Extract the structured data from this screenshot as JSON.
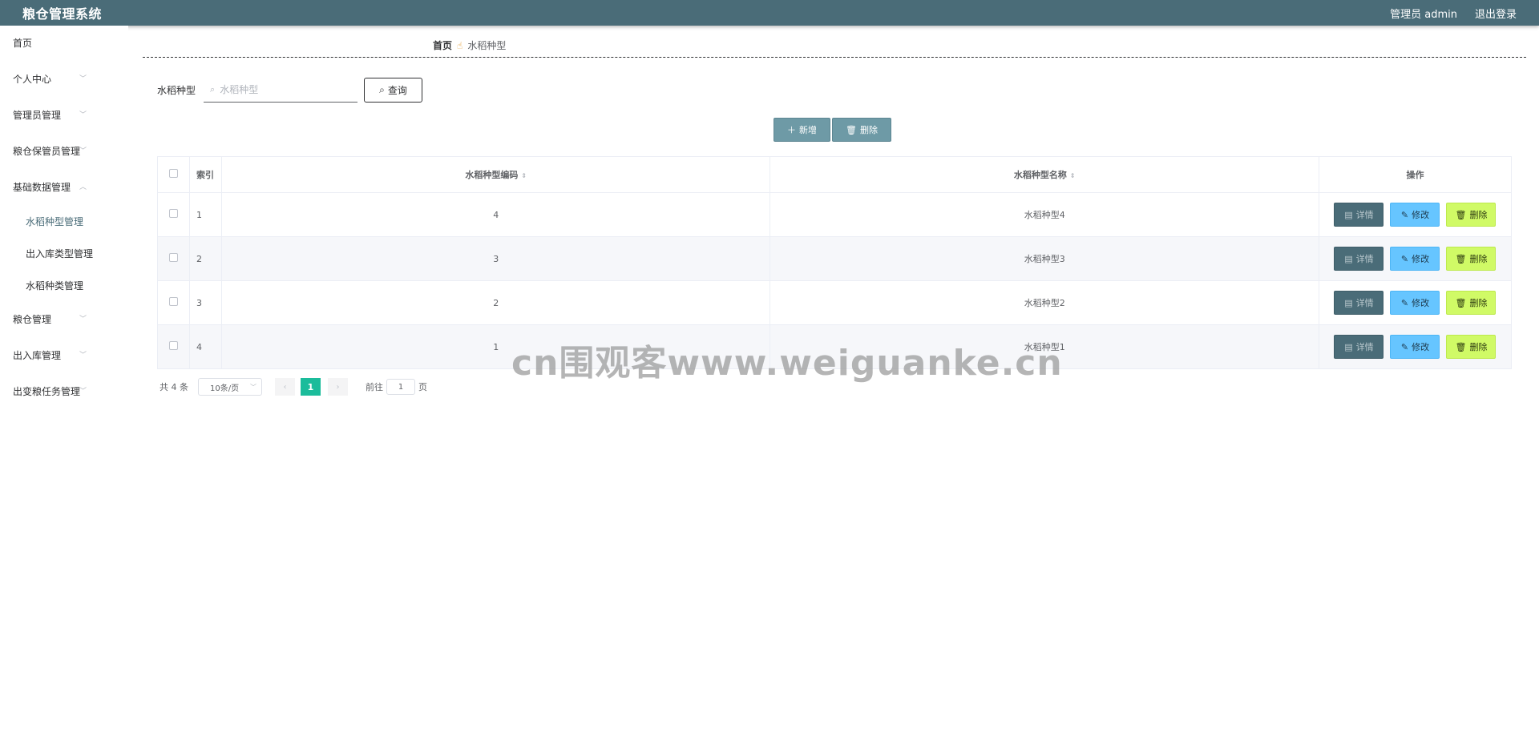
{
  "header": {
    "title": "粮仓管理系统",
    "user_label": "管理员 admin",
    "logout_label": "退出登录"
  },
  "sidebar": {
    "items": [
      {
        "label": "首页"
      },
      {
        "label": "个人中心"
      },
      {
        "label": "管理员管理"
      },
      {
        "label": "粮仓保管员管理"
      },
      {
        "label": "基础数据管理"
      },
      {
        "label": "粮仓管理"
      },
      {
        "label": "出入库管理"
      },
      {
        "label": "出变粮任务管理"
      }
    ],
    "submenu": [
      {
        "label": "水稻种型管理"
      },
      {
        "label": "出入库类型管理"
      },
      {
        "label": "水稻种类管理"
      }
    ]
  },
  "breadcrumb": {
    "home": "首页",
    "current": "水稻种型"
  },
  "search": {
    "label": "水稻种型",
    "placeholder": "水稻种型",
    "query_label": "查询"
  },
  "actions": {
    "add_label": "新增",
    "delete_label": "删除"
  },
  "table": {
    "headers": {
      "index": "索引",
      "code": "水稻种型编码",
      "name": "水稻种型名称",
      "ops": "操作"
    },
    "rows": [
      {
        "index": "1",
        "code": "4",
        "name": "水稻种型4"
      },
      {
        "index": "2",
        "code": "3",
        "name": "水稻种型3"
      },
      {
        "index": "3",
        "code": "2",
        "name": "水稻种型2"
      },
      {
        "index": "4",
        "code": "1",
        "name": "水稻种型1"
      }
    ],
    "op_labels": {
      "detail": "详情",
      "edit": "修改",
      "delete": "删除"
    }
  },
  "pagination": {
    "total": "共 4 条",
    "page_size": "10条/页",
    "current_page": "1",
    "goto_label": "前往",
    "goto_value": "1",
    "page_suffix": "页"
  },
  "watermark": "cn围观客www.weiguanke.cn",
  "colors": {
    "header_bg": "#4a6c78",
    "active_page": "#1bbc9b",
    "detail_btn": "#4a6c78",
    "edit_btn": "#66c5ff",
    "delete_btn": "#d0fa66"
  }
}
